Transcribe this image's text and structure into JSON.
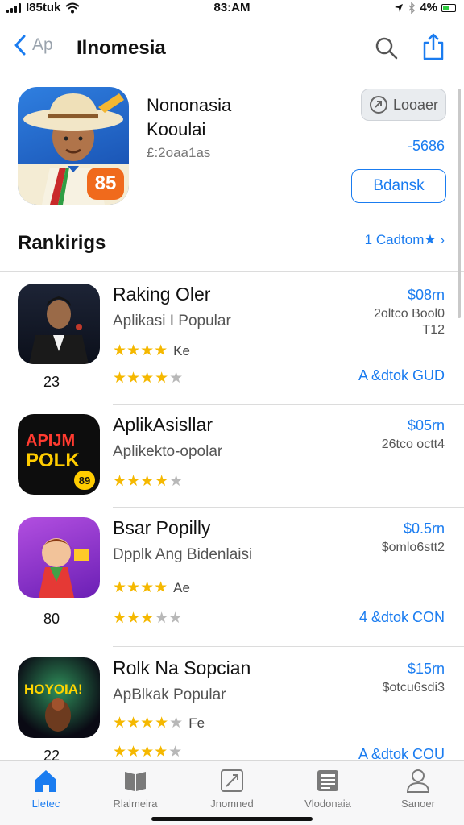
{
  "status_bar": {
    "carrier": "I85tuk",
    "time": "83:AM",
    "battery": "4%"
  },
  "nav": {
    "back_label": "Ap",
    "title": "Ilnomesia"
  },
  "hero": {
    "title_line1": "Nononasia",
    "title_line2": "Kooulai",
    "subtitle": "£:2oaa1as",
    "badge": "85",
    "get_label": "Looaer",
    "price": "-5686",
    "open_label": "Bdansk"
  },
  "rankings": {
    "title": "Rankirigs",
    "link": "1 Cadtom★ ›"
  },
  "rows": [
    {
      "rank": "23",
      "name": "Raking Oler",
      "subtitle": "Aplikasi I Popular",
      "rating_text": "Ke",
      "price": "$08rn",
      "meta1": "2oltco Bool0",
      "meta2": "T12",
      "action": "A &dtok GUD",
      "stars1": 4,
      "stars2": 3.5
    },
    {
      "rank": "",
      "name": "AplikAsisllar",
      "subtitle": "Aplikekto-opolar",
      "rating_text": "",
      "price": "$05rn",
      "meta1": "26tco octt4",
      "meta2": "",
      "action": "",
      "stars1": 3.5,
      "stars2": 0,
      "icon_text1": "APIJM",
      "icon_text2": "POLK",
      "icon_badge": "89"
    },
    {
      "rank": "80",
      "name": "Bsar Popilly",
      "subtitle": "Dpplk Ang Bidenlaisi",
      "rating_text": "Ae",
      "price": "$0.5rn",
      "meta1": "$omlo6stt2",
      "meta2": "",
      "action": "4 &dtok CON",
      "stars1": 4,
      "stars2": 3
    },
    {
      "rank": "22",
      "name": "Rolk Na Sopcian",
      "subtitle": "ApBlkak Popular",
      "rating_text": "Fe",
      "price": "$15rn",
      "meta1": "$otcu6sdi3",
      "meta2": "",
      "action": "A &dtok COU",
      "stars1": 3.5,
      "stars2": 4,
      "icon_text1": "HOYOIA!"
    }
  ],
  "tabs": [
    {
      "label": "Lletec",
      "icon": "home-icon"
    },
    {
      "label": "Rlalmeira",
      "icon": "book-icon"
    },
    {
      "label": "Jnomned",
      "icon": "edit-icon"
    },
    {
      "label": "Vlodonaia",
      "icon": "newspaper-icon"
    },
    {
      "label": "Sanoer",
      "icon": "profile-icon"
    }
  ],
  "colors": {
    "accent": "#1a7cf0",
    "star": "#f5b800",
    "badge": "#f06a1c"
  }
}
